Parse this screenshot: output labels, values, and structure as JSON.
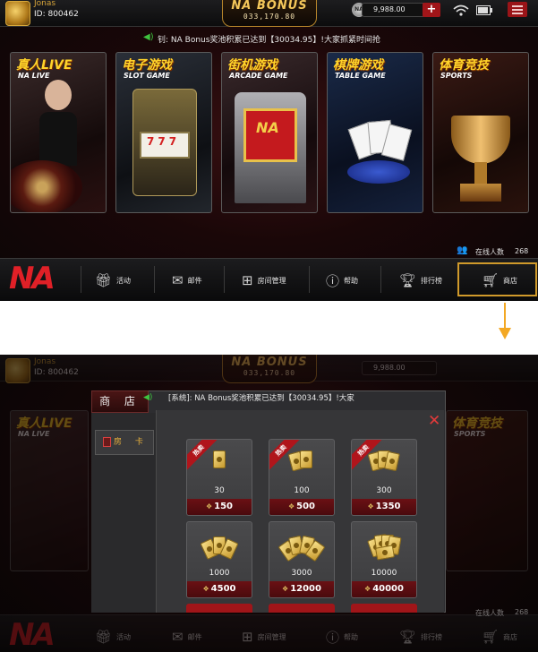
{
  "top": {
    "user": {
      "name": "Jonas",
      "id": "ID: 800462"
    },
    "logo": {
      "line1": "NA BONUS",
      "line2": "033,170.80"
    },
    "balance": "9,988.00",
    "plus": "+",
    "marquee": "钊: NA Bonus奖池积累已达到【30034.95】!大家抓紧时间抢",
    "games": [
      {
        "zh": "真人LIVE",
        "en": "NA LIVE"
      },
      {
        "zh": "电子游戏",
        "en": "SLOT GAME"
      },
      {
        "zh": "街机游戏",
        "en": "ARCADE GAME"
      },
      {
        "zh": "棋牌游戏",
        "en": "TABLE GAME"
      },
      {
        "zh": "体育竞技",
        "en": "SPORTS"
      }
    ],
    "online_label": "在线人数",
    "online_count": "268",
    "brand": "NA",
    "nav": [
      {
        "label": "活动",
        "icon": "gift-icon"
      },
      {
        "label": "邮件",
        "icon": "mail-icon"
      },
      {
        "label": "房间管理",
        "icon": "grid-icon"
      },
      {
        "label": "帮助",
        "icon": "help-icon"
      },
      {
        "label": "排行榜",
        "icon": "trophy-icon"
      },
      {
        "label": "商店",
        "icon": "cart-icon"
      }
    ]
  },
  "bottom": {
    "user": {
      "name": "Jonas",
      "id": "ID: 800462"
    },
    "logo": {
      "line1": "NA BONUS",
      "line2": "033,170.80"
    },
    "balance": "9,988.00",
    "shop_title": "商 店",
    "marquee": "[系统]: NA Bonus奖池积累已达到【30034.95】!大家",
    "category": "房 卡",
    "ribbon": "热卖",
    "items": [
      {
        "amount": "30",
        "price": "150",
        "hot": true
      },
      {
        "amount": "100",
        "price": "500",
        "hot": true
      },
      {
        "amount": "300",
        "price": "1350",
        "hot": true
      },
      {
        "amount": "1000",
        "price": "4500",
        "hot": false
      },
      {
        "amount": "3000",
        "price": "12000",
        "hot": false
      },
      {
        "amount": "10000",
        "price": "40000",
        "hot": false
      }
    ],
    "online_label": "在线人数",
    "online_count": "268",
    "peek_game_left": {
      "zh": "真人LIVE",
      "en": "NA LIVE"
    },
    "peek_game_right": {
      "zh": "体育竞技",
      "en": "SPORTS"
    },
    "nav": [
      "活动",
      "邮件",
      "房间管理",
      "帮助",
      "排行榜",
      "商店"
    ]
  },
  "colors": {
    "accent_red": "#a01519",
    "gold": "#f3c65a",
    "highlight": "#d09a2b",
    "arrow": "#f3a824"
  }
}
